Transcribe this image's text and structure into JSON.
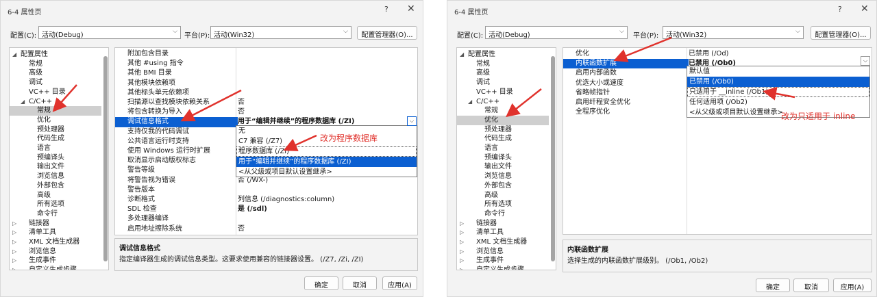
{
  "left": {
    "title": "6-4 属性页",
    "help": "?",
    "close": "✕",
    "config_label": "配置(C):",
    "config_value": "活动(Debug)",
    "platform_label": "平台(P):",
    "platform_value": "活动(Win32)",
    "config_manager": "配置管理器(O)...",
    "tree": [
      "配置属性",
      "常规",
      "高级",
      "调试",
      "VC++ 目录",
      "C/C++",
      "常规",
      "优化",
      "预处理器",
      "代码生成",
      "语言",
      "预编译头",
      "输出文件",
      "浏览信息",
      "外部包含",
      "高级",
      "所有选项",
      "命令行",
      "链接器",
      "清单工具",
      "XML 文档生成器",
      "浏览信息",
      "生成事件",
      "自定义生成步骤"
    ],
    "props": [
      {
        "k": "附加包含目录",
        "v": ""
      },
      {
        "k": "其他 #using 指令",
        "v": ""
      },
      {
        "k": "其他 BMI 目录",
        "v": ""
      },
      {
        "k": "其他模块依赖项",
        "v": ""
      },
      {
        "k": "其他标头单元依赖项",
        "v": ""
      },
      {
        "k": "扫描源以查找模块依赖关系",
        "v": "否"
      },
      {
        "k": "将包含转换为导入",
        "v": "否"
      },
      {
        "k": "调试信息格式",
        "v": "用于“编辑并继续”的程序数据库 (/ZI)"
      },
      {
        "k": "支持仅我的代码调试",
        "v": ""
      },
      {
        "k": "公共语言运行时支持",
        "v": ""
      },
      {
        "k": "使用 Windows 运行时扩展",
        "v": ""
      },
      {
        "k": "取消显示启动版权标志",
        "v": ""
      },
      {
        "k": "警告等级",
        "v": ""
      },
      {
        "k": "将警告视为错误",
        "v": "否 (/WX-)"
      },
      {
        "k": "警告版本",
        "v": ""
      },
      {
        "k": "诊断格式",
        "v": "列信息 (/diagnostics:column)"
      },
      {
        "k": "SDL 检查",
        "v": "是 (/sdl)"
      },
      {
        "k": "多处理器编译",
        "v": ""
      },
      {
        "k": "启用地址擦除系统",
        "v": "否"
      }
    ],
    "dropdown": [
      "无",
      "C7 兼容 (/Z7)",
      "程序数据库 (/Zi)",
      "用于“编辑并继续”的程序数据库 (/ZI)",
      "<从父级或项目默认设置继承>"
    ],
    "annotation": "改为程序数据库",
    "desc_title": "调试信息格式",
    "desc_text": "指定编译器生成的调试信息类型。这要求使用兼容的链接器设置。    (/Z7, /Zi, /ZI)",
    "ok": "确定",
    "cancel": "取消",
    "apply": "应用(A)"
  },
  "right": {
    "title": "6-4 属性页",
    "help": "?",
    "close": "✕",
    "config_label": "配置(C):",
    "config_value": "活动(Debug)",
    "platform_label": "平台(P):",
    "platform_value": "活动(Win32)",
    "config_manager": "配置管理器(O)...",
    "tree": [
      "配置属性",
      "常规",
      "高级",
      "调试",
      "VC++ 目录",
      "C/C++",
      "常规",
      "优化",
      "预处理器",
      "代码生成",
      "语言",
      "预编译头",
      "输出文件",
      "浏览信息",
      "外部包含",
      "高级",
      "所有选项",
      "命令行",
      "链接器",
      "清单工具",
      "XML 文档生成器",
      "浏览信息",
      "生成事件",
      "自定义生成步骤"
    ],
    "props": [
      {
        "k": "优化",
        "v": "已禁用 (/Od)"
      },
      {
        "k": "内联函数扩展",
        "v": "已禁用 (/Ob0)"
      },
      {
        "k": "启用内部函数",
        "v": ""
      },
      {
        "k": "优选大小或速度",
        "v": ""
      },
      {
        "k": "省略帧指针",
        "v": ""
      },
      {
        "k": "启用纤程安全优化",
        "v": ""
      },
      {
        "k": "全程序优化",
        "v": ""
      }
    ],
    "dropdown": [
      "默认值",
      "已禁用 (/Ob0)",
      "只适用于 __inline (/Ob1)",
      "任何适用项 (/Ob2)",
      "<从父级或项目默认设置继承>"
    ],
    "annotation": "改为只适用于 inline",
    "desc_title": "内联函数扩展",
    "desc_text": "选择生成的内联函数扩展级别。    (/Ob1, /Ob2)",
    "ok": "确定",
    "cancel": "取消",
    "apply": "应用(A)"
  },
  "colors": {
    "selection": "#0b5fd1",
    "annotation": "#e0322c"
  }
}
